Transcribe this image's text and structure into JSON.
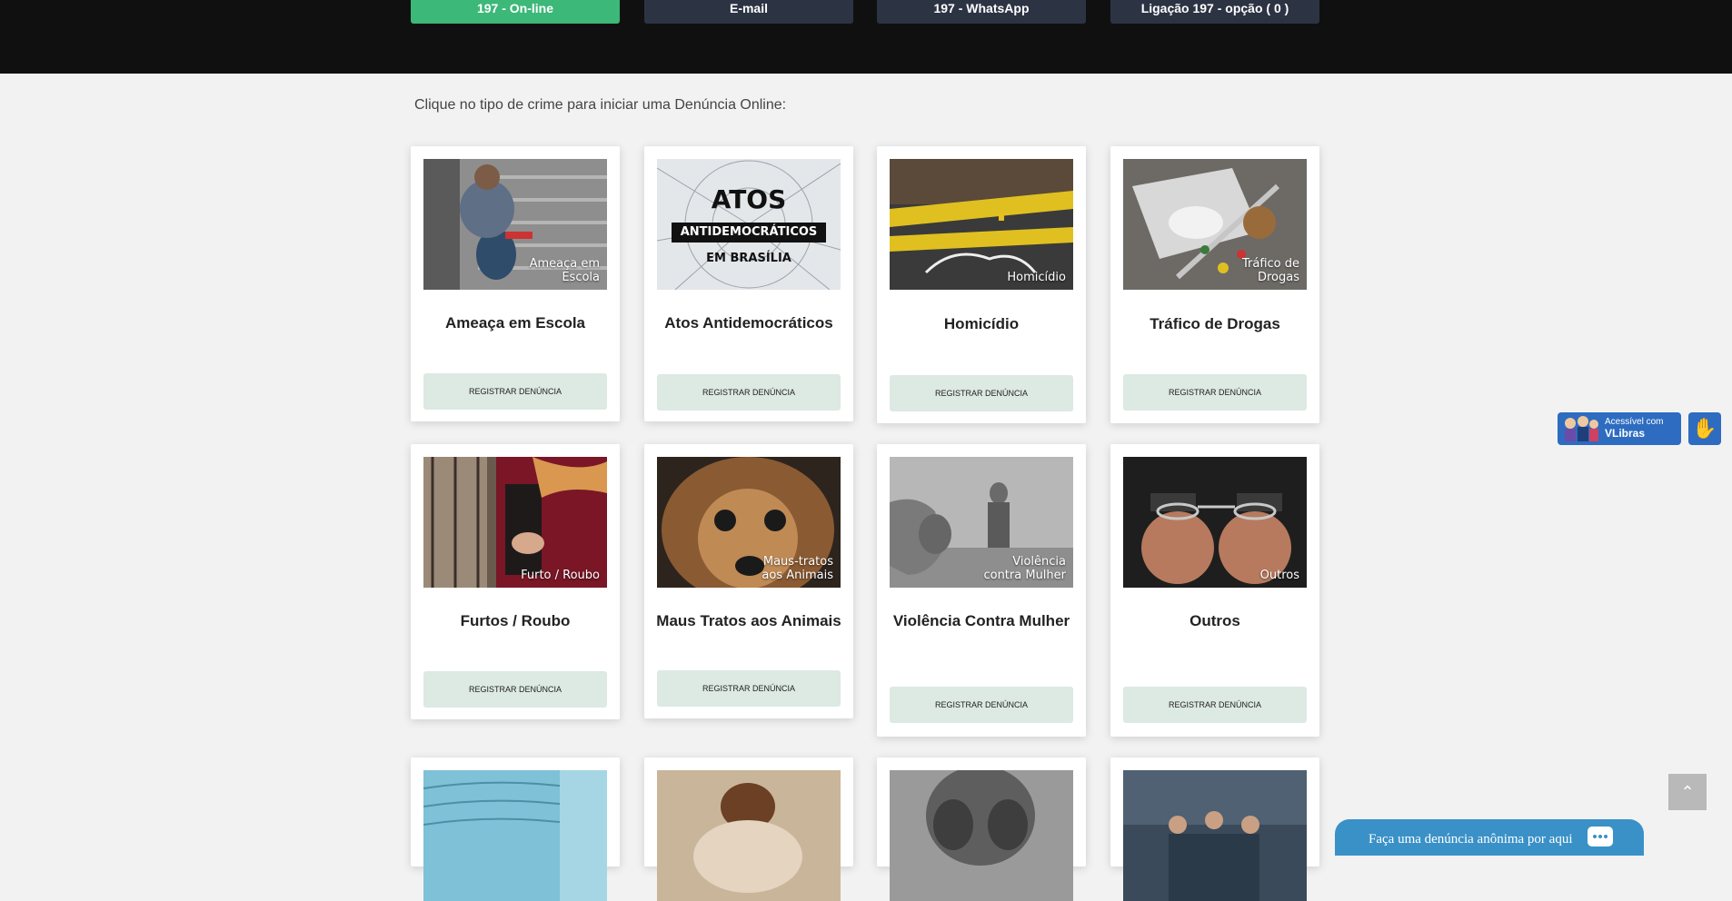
{
  "top_buttons": [
    {
      "label": "197 - On-line",
      "color": "#3cb878"
    },
    {
      "label": "E-mail",
      "color": "#2c3444"
    },
    {
      "label": "197 - WhatsApp",
      "color": "#2c3444"
    },
    {
      "label": "Ligação 197 - opção ( 0 )",
      "color": "#2c3444"
    }
  ],
  "intro": "Clique no tipo de crime para iniciar uma Denúncia Online:",
  "register_label": "REGISTRAR DENÚNCIA",
  "cards": [
    {
      "title": "Ameaça em Escola",
      "overlay": [
        "Ameaça em",
        "Escola"
      ]
    },
    {
      "title": "Atos Antidemocráticos",
      "image_text": [
        "ATOS",
        "ANTIDEMOCRÁTICOS",
        "EM BRASÍLIA"
      ]
    },
    {
      "title": "Homicídio",
      "overlay": [
        "Homicídio"
      ]
    },
    {
      "title": "Tráfico de Drogas",
      "overlay": [
        "Tráfico de",
        "Drogas"
      ]
    },
    {
      "title": "Furtos / Roubo",
      "overlay": [
        "Furto / Roubo"
      ]
    },
    {
      "title": "Maus Tratos aos Animais",
      "overlay": [
        "Maus-tratos",
        "aos Animais"
      ]
    },
    {
      "title": "Violência Contra Mulher",
      "overlay": [
        "Violência",
        "contra Mulher"
      ]
    },
    {
      "title": "Outros",
      "overlay": [
        "Outros"
      ]
    }
  ],
  "vlibras": {
    "line1": "Acessível com",
    "line2": "VLibras"
  },
  "chat": {
    "label": "Faça uma denúncia anônima por aqui"
  },
  "colors": {
    "accent_green": "#3cb878",
    "dark_button": "#2c3444",
    "register_bg": "#dde9e3",
    "vlibras_blue": "#2d6cc0",
    "chat_blue": "#3a91c7"
  }
}
